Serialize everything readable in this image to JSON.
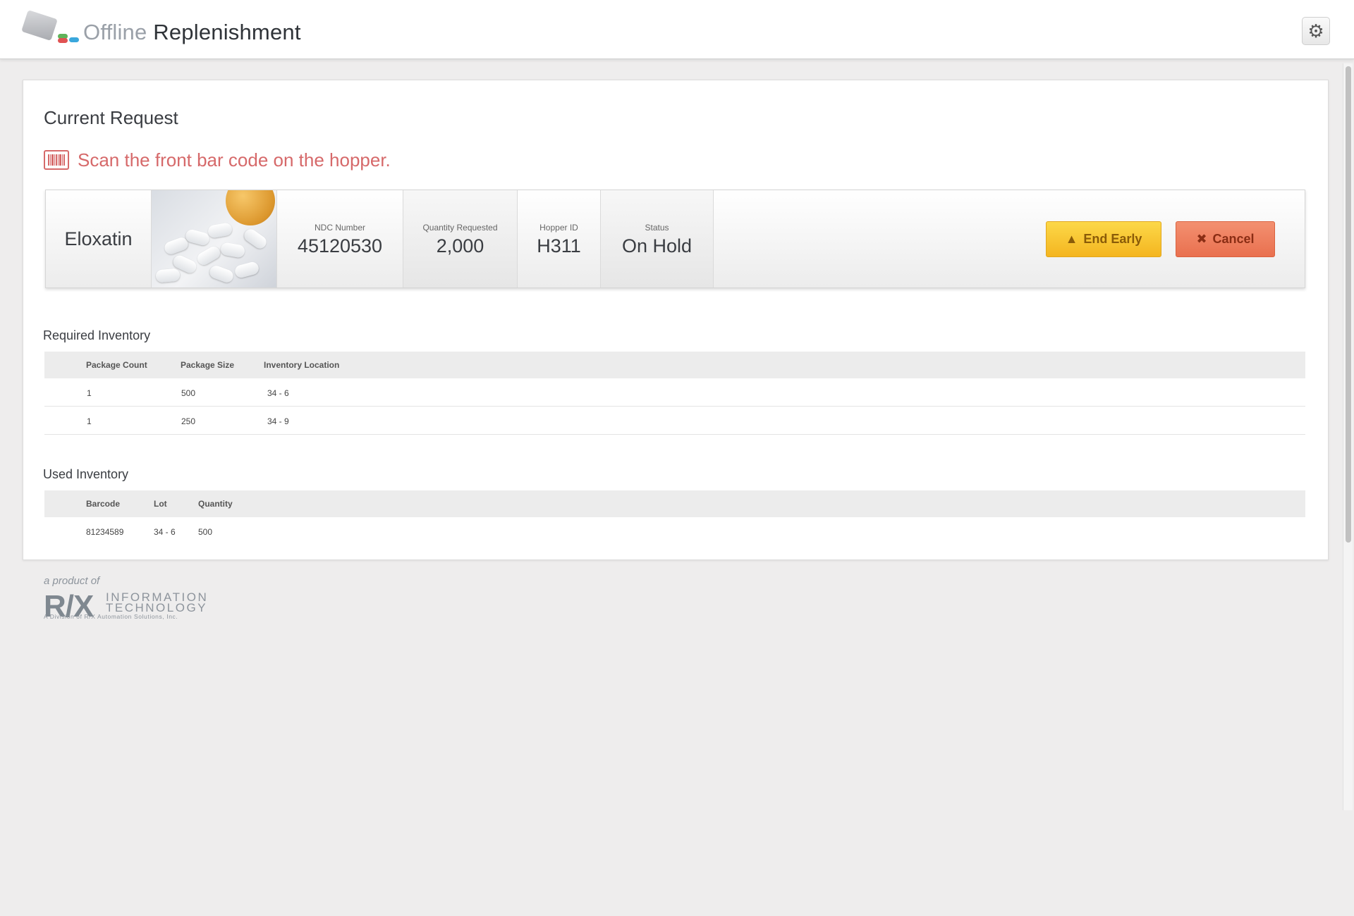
{
  "header": {
    "title_light": "Offline",
    "title_dark": "Replenishment",
    "settings_icon": "gear-icon"
  },
  "request": {
    "section_title": "Current Request",
    "instruction": "Scan the front bar code on the hopper.",
    "drug_name": "Eloxatin",
    "ndc_label": "NDC Number",
    "ndc_value": "45120530",
    "qty_label": "Quantity Requested",
    "qty_value": "2,000",
    "hopper_label": "Hopper ID",
    "hopper_value": "H311",
    "status_label": "Status",
    "status_value": "On Hold",
    "end_early_label": "End Early",
    "cancel_label": "Cancel"
  },
  "required": {
    "title": "Required Inventory",
    "headers": [
      "Package Count",
      "Package Size",
      "Inventory Location"
    ],
    "rows": [
      [
        "1",
        "500",
        "34 - 6"
      ],
      [
        "1",
        "250",
        "34 - 9"
      ]
    ]
  },
  "used": {
    "title": "Used Inventory",
    "headers": [
      "Barcode",
      "Lot",
      "Quantity"
    ],
    "rows": [
      [
        "81234589",
        "34 - 6",
        "500"
      ]
    ]
  },
  "footer": {
    "tagline": "a product of",
    "brand_mark": "R/X",
    "brand_line1": "INFORMATION",
    "brand_line2": "TECHNOLOGY",
    "division": "A Division of R/X Automation Solutions, Inc."
  },
  "colors": {
    "instruction": "#d6696a",
    "end_early": "#f7c531",
    "cancel": "#ec7b5a"
  }
}
